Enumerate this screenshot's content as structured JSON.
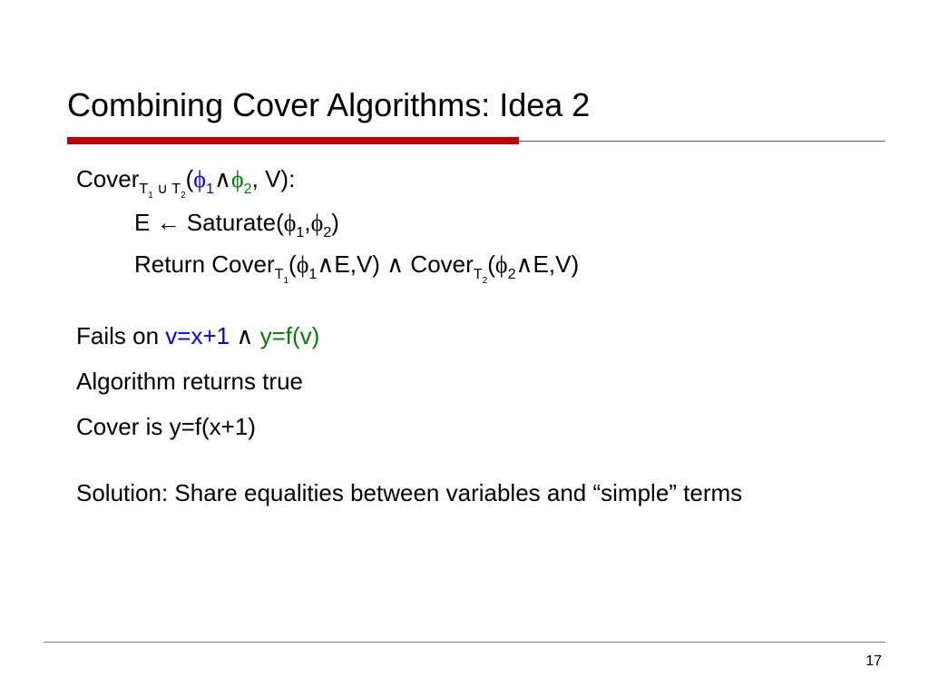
{
  "title": "Combining Cover Algorithms: Idea 2",
  "line1": {
    "pre": "Cover",
    "sub_a": "T",
    "sub_a1": "1",
    "union": " ∪ ",
    "sub_b": "T",
    "sub_b1": "2",
    "open": "(",
    "phi1": "ϕ",
    "s1": "1",
    "wedge": "∧",
    "phi2": "ϕ",
    "s2": "2",
    "tail": ", V):"
  },
  "line2": {
    "pre": "E ← Saturate(",
    "phi1": "ϕ",
    "s1": "1",
    "comma": ",",
    "phi2": "ϕ",
    "s2": "2",
    "tail": ")"
  },
  "line3": {
    "pre": "Return Cover",
    "subT1a": "T",
    "subT1b": "1",
    "open1": "(",
    "phi1": "ϕ",
    "s1": "1",
    "mid1": "∧E,V) ∧ Cover",
    "subT2a": "T",
    "subT2b": "2",
    "open2": "(",
    "phi2": "ϕ",
    "s2": "2",
    "tail": "∧E,V)"
  },
  "fails": {
    "pre": "Fails on ",
    "blue": "v=x+1",
    "wedge": " ∧ ",
    "green": "y=f(v)"
  },
  "alg_true": "Algorithm returns true",
  "cover_is": "Cover is y=f(x+1)",
  "solution": "Solution: Share equalities between variables and “simple” terms",
  "page": "17"
}
